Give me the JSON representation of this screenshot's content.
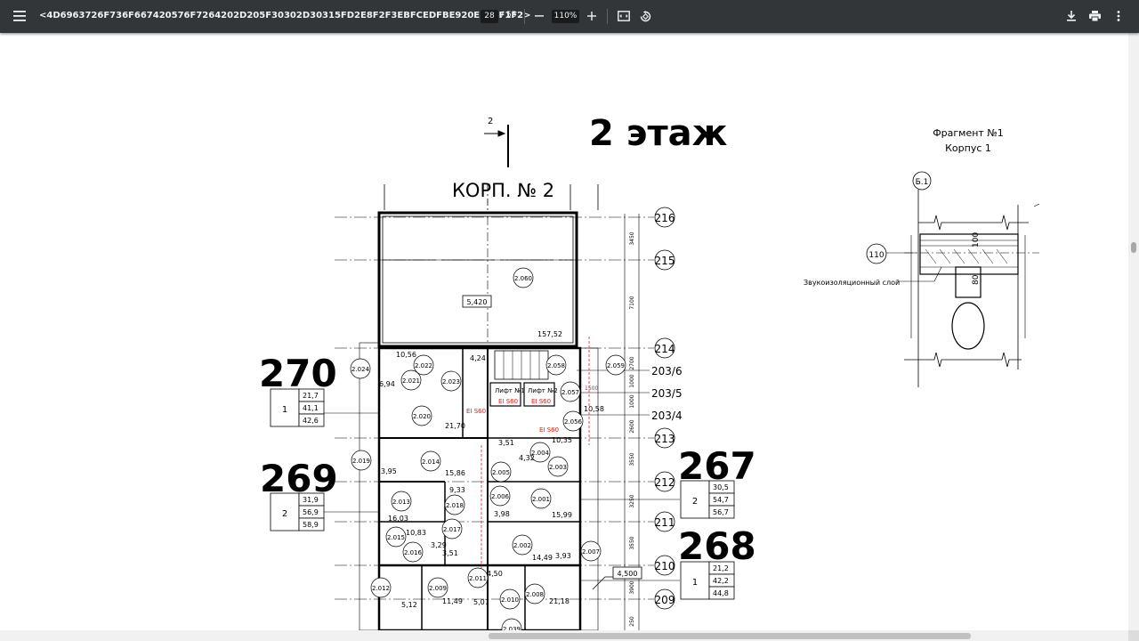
{
  "toolbar": {
    "title": "<4D6963726F736F667420576F7264202D205F30302D30315FD2E8F2F3EBFCEDFBE920EBE8F1F2>",
    "page_current": "28",
    "page_separator": "/",
    "page_total": "55",
    "zoom": "110%",
    "icons": {
      "menu": "hamburger-menu-icon",
      "zoom_out": "minus-icon",
      "zoom_in": "plus-icon",
      "fit": "fit-to-page-icon",
      "rotate": "rotate-icon",
      "download": "download-icon",
      "print": "print-icon",
      "more": "more-vertical-icon"
    }
  },
  "colors": {
    "toolbar_bg": "#323639",
    "toolbar_text": "#f1f1f1",
    "page_bg": "#ffffff",
    "annotation_red": "#e0201b"
  },
  "drawing": {
    "floor_title": "2 этаж",
    "building_title": "КОРП. № 2",
    "section_marker": "2",
    "fragment_title": "Фрагмент №1",
    "fragment_subtitle": "Корпус 1",
    "fragment_axis": "Б.1",
    "fragment_ref": "110",
    "sound_layer_label": "Звукоизоляционный слой",
    "fragment_dims": [
      "100",
      "80"
    ],
    "apartments": [
      {
        "number": "270",
        "rooms": "1",
        "areas": [
          "21,7",
          "41,1",
          "42,6"
        ]
      },
      {
        "number": "269",
        "rooms": "2",
        "areas": [
          "31,9",
          "56,9",
          "58,9"
        ]
      },
      {
        "number": "267",
        "rooms": "2",
        "areas": [
          "30,5",
          "54,7",
          "56,7"
        ]
      },
      {
        "number": "268",
        "rooms": "1",
        "areas": [
          "21,2",
          "42,2",
          "44,8"
        ]
      }
    ],
    "axes": [
      "216",
      "215",
      "214",
      "203/6",
      "203/5",
      "203/4",
      "213",
      "212",
      "211",
      "210",
      "209"
    ],
    "dimensions": [
      "3450",
      "7100",
      "2700",
      "1000",
      "1000",
      "2600",
      "3550",
      "3250",
      "3550",
      "3900",
      "250"
    ],
    "level_marks": [
      "5,420",
      "4,500"
    ],
    "room_codes": [
      "2.060",
      "2.024",
      "2.022",
      "2.021",
      "2.023",
      "2.020",
      "2.019",
      "2.014",
      "2.013",
      "2.018",
      "2.015",
      "2.016",
      "2.017",
      "2.012",
      "2.009",
      "2.011",
      "2.010",
      "2.008",
      "2.059",
      "2.058",
      "2.057",
      "2.056",
      "2.005",
      "2.004",
      "2.003",
      "2.006",
      "2.001",
      "2.002",
      "2.007",
      "2.039"
    ],
    "room_areas": [
      "157,52",
      "10,56",
      "4,24",
      "6,94",
      "21,70",
      "3,95",
      "15,86",
      "9,33",
      "16,03",
      "10,83",
      "3,51",
      "3,29",
      "5,12",
      "11,49",
      "5,07",
      "21,18",
      "10,58",
      "3,51",
      "10,35",
      "4,32",
      "15,99",
      "3,98",
      "14,49",
      "3,93",
      "4,50"
    ],
    "lift_labels": [
      "Лифт №1",
      "Лифт №2"
    ],
    "fire_labels": [
      "EI S60",
      "EI S60",
      "EI S60",
      "EI S60"
    ],
    "dim_1500": "1500"
  }
}
